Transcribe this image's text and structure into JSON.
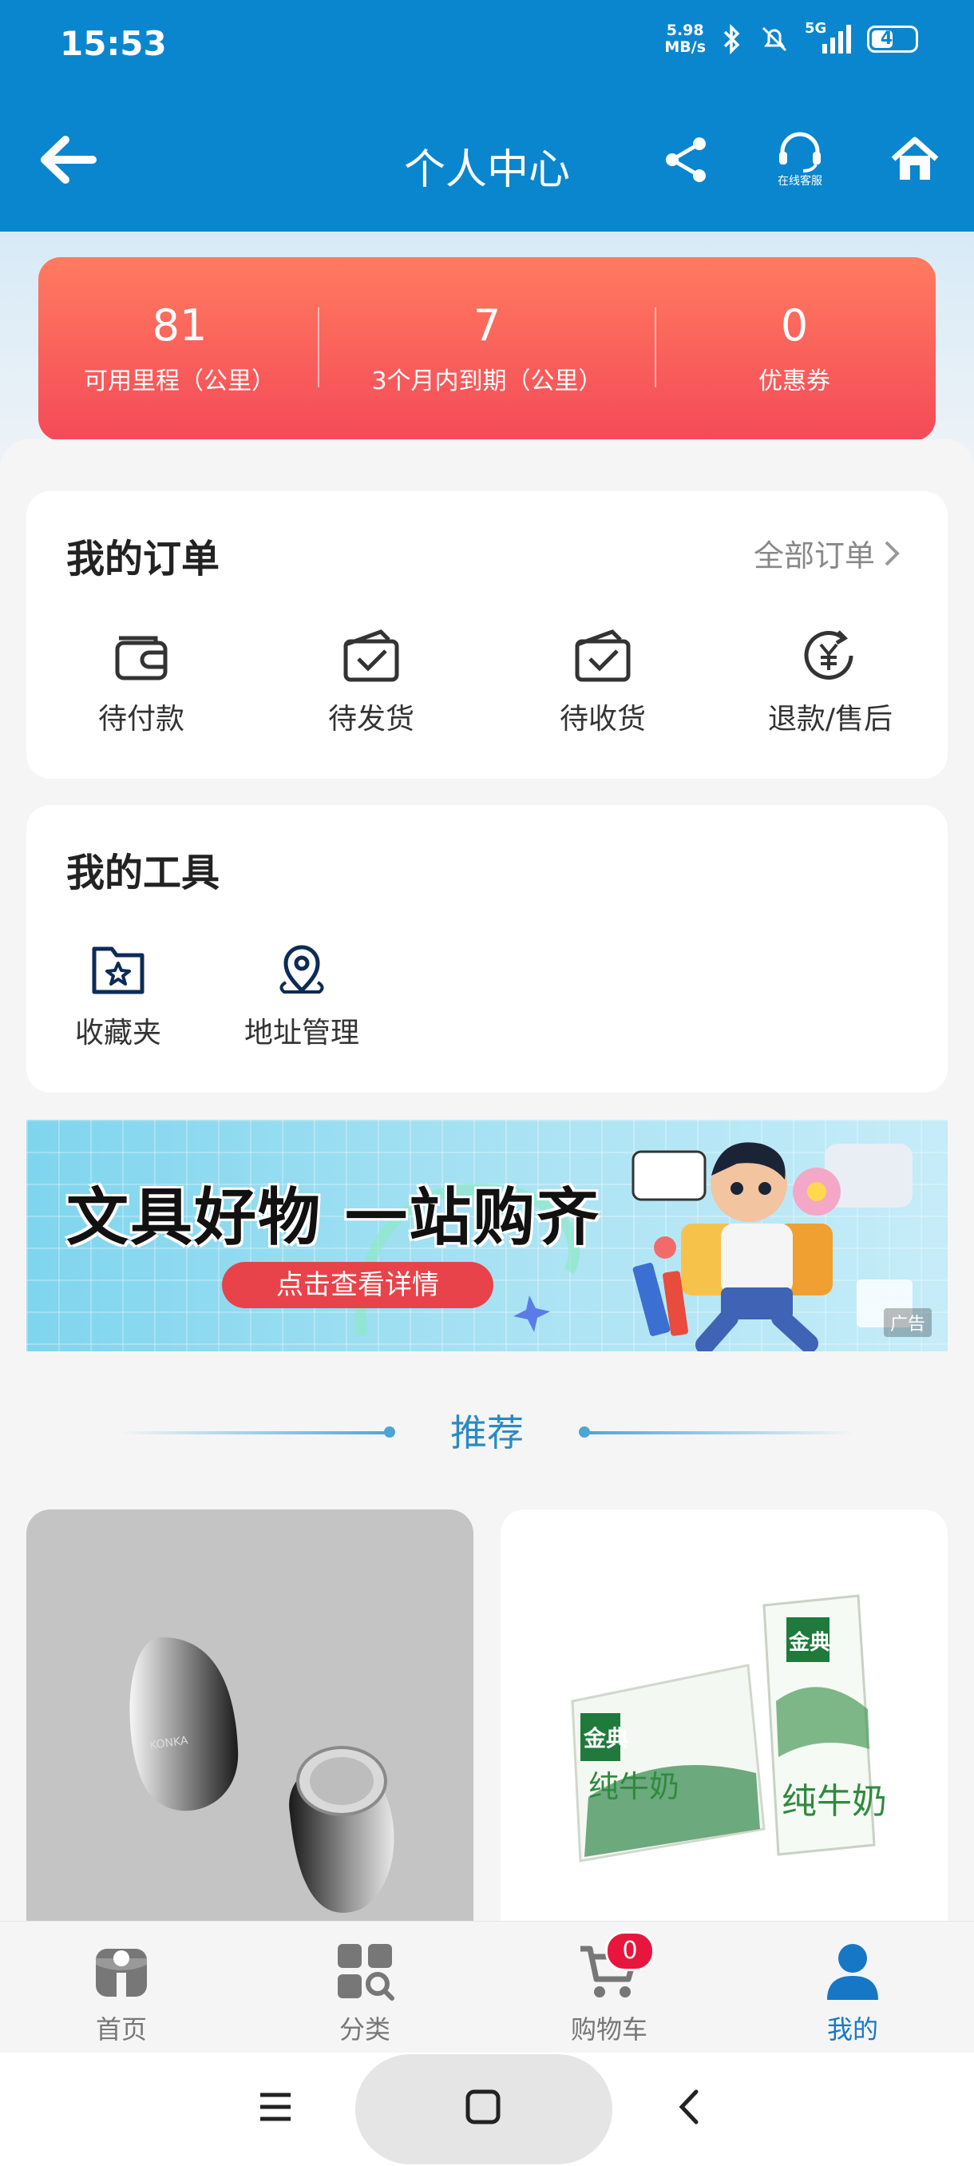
{
  "status_bar": {
    "time": "15:53",
    "net_speed_value": "5.98",
    "net_speed_unit": "MB/s",
    "network": "5G",
    "battery": "41"
  },
  "header": {
    "title": "个人中心",
    "customer_service_label": "在线客服"
  },
  "stats": [
    {
      "value": "81",
      "label": "可用里程（公里）"
    },
    {
      "value": "7",
      "label": "3个月内到期（公里）"
    },
    {
      "value": "0",
      "label": "优惠券"
    }
  ],
  "orders": {
    "title": "我的订单",
    "all_label": "全部订单",
    "items": [
      {
        "label": "待付款",
        "icon": "wallet-icon"
      },
      {
        "label": "待发货",
        "icon": "box-check-icon"
      },
      {
        "label": "待收货",
        "icon": "box-check-icon"
      },
      {
        "label": "退款/售后",
        "icon": "yuan-refund-icon"
      }
    ]
  },
  "tools": {
    "title": "我的工具",
    "items": [
      {
        "label": "收藏夹",
        "icon": "star-folder-icon"
      },
      {
        "label": "地址管理",
        "icon": "location-pin-icon"
      }
    ]
  },
  "banner": {
    "title": "文具好物 一站购齐",
    "button": "点击查看详情",
    "ad_label": "广告"
  },
  "recommend": {
    "title": "推荐"
  },
  "products": [
    {
      "brand": "KONKA",
      "image": "shaver-product-image"
    },
    {
      "brand": "金典",
      "sub": "纯牛奶",
      "image": "milk-product-image"
    }
  ],
  "tabbar": {
    "cart_badge": "0",
    "items": [
      {
        "label": "首页",
        "icon": "home-store-icon"
      },
      {
        "label": "分类",
        "icon": "category-icon"
      },
      {
        "label": "购物车",
        "icon": "cart-icon"
      },
      {
        "label": "我的",
        "icon": "person-icon"
      }
    ]
  },
  "colors": {
    "primary": "#0A86CF",
    "accent_red": "#F44A58",
    "tab_active": "#1677C6"
  }
}
